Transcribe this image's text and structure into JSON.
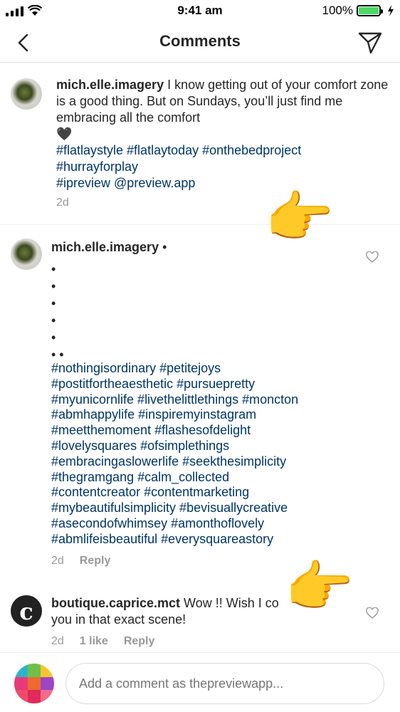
{
  "status_bar": {
    "time": "9:41 am",
    "battery": "100%"
  },
  "header": {
    "title": "Comments"
  },
  "caption": {
    "username": "mich.elle.imagery",
    "text": " I know getting out of your comfort zone is a good thing. But on Sundays, you’ll just find me embracing all the comfort",
    "emoji": "🖤",
    "hashtags_line1": " #flatlaystyle #flatlaytoday #onthebedproject",
    "hashtags_line2": "#hurrayforplay",
    "hashtags_line3": "#ipreview @preview.app",
    "time": "2d"
  },
  "comments": [
    {
      "username": "mich.elle.imagery",
      "dot_after_name": "•",
      "dots": [
        "•",
        "•",
        "•",
        "•",
        "•",
        "• •"
      ],
      "hashtag_lines": [
        " #nothingisordinary #petitejoys",
        "#postitfortheaesthetic #pursuepretty",
        "#myunicornlife #livethelittlethings #moncton",
        "#abmhappylife  #inspiremyinstagram",
        "#meetthemoment #flashesofdelight",
        "#lovelysquares #ofsimplethings",
        "#embracingaslowerlife  #seekthesimplicity",
        "#thegramgang  #calm_collected",
        "#contentcreator #contentmarketing",
        "#mybeautifulsimplicity  #bevisuallycreative",
        "#asecondofwhimsey #amonthoflovely",
        "#abmlifeisbeautiful #everysquareastory"
      ],
      "time": "2d",
      "reply": "Reply"
    },
    {
      "username": "boutique.caprice.mct",
      "avatar_letter": "c",
      "text_line1": " Wow !! Wish I co",
      "text_line2": "you in that exact scene!",
      "time": "2d",
      "likes": "1 like",
      "reply": "Reply"
    }
  ],
  "composer": {
    "placeholder": "Add a comment as thepreviewapp..."
  },
  "icons": {
    "back": "chevron-left-icon",
    "send": "paper-plane-icon",
    "like": "heart-outline-icon",
    "pointer": "pointing-hand-emoji"
  },
  "colors": {
    "hashtag": "#003569",
    "meta": "#999999",
    "divider": "#dbdbdb",
    "battery": "#4cd964"
  }
}
